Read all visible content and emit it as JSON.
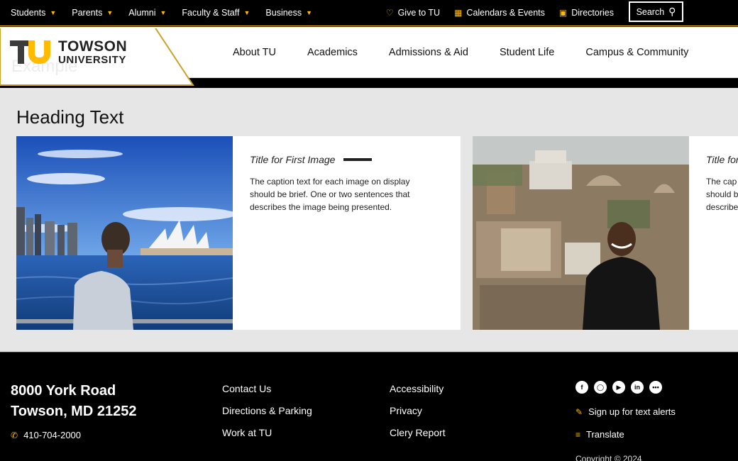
{
  "topbar": {
    "nav": [
      {
        "label": "Students"
      },
      {
        "label": "Parents"
      },
      {
        "label": "Alumni"
      },
      {
        "label": "Faculty & Staff"
      },
      {
        "label": "Business"
      }
    ],
    "give": "Give to TU",
    "calendars": "Calendars & Events",
    "directories": "Directories",
    "search_label": "Search"
  },
  "brand": {
    "line1": "TOWSON",
    "line2": "UNIVERSITY",
    "ghost": "Example",
    "accent": "#ffbb00"
  },
  "mainnav": [
    {
      "label": "About TU"
    },
    {
      "label": "Academics"
    },
    {
      "label": "Admissions & Aid"
    },
    {
      "label": "Student Life"
    },
    {
      "label": "Campus & Community"
    }
  ],
  "content": {
    "heading": "Heading Text",
    "cards": [
      {
        "title": "Title for First Image",
        "caption": "The caption text for each image on display should be brief. One or two sentences that describes the image being presented."
      },
      {
        "title": "Title for",
        "caption": "The cap should b describe"
      }
    ]
  },
  "footer": {
    "address_line1": "8000 York Road",
    "address_line2": "Towson, MD 21252",
    "phone": "410-704-2000",
    "col1": [
      "Contact Us",
      "Directions & Parking",
      "Work at TU"
    ],
    "col2": [
      "Accessibility",
      "Privacy",
      "Clery Report"
    ],
    "social": [
      "facebook-icon",
      "instagram-icon",
      "youtube-icon",
      "linkedin-icon",
      "more-icon"
    ],
    "text_alerts": "Sign up for text alerts",
    "translate": "Translate",
    "copyright": "Copyright © 2024"
  }
}
